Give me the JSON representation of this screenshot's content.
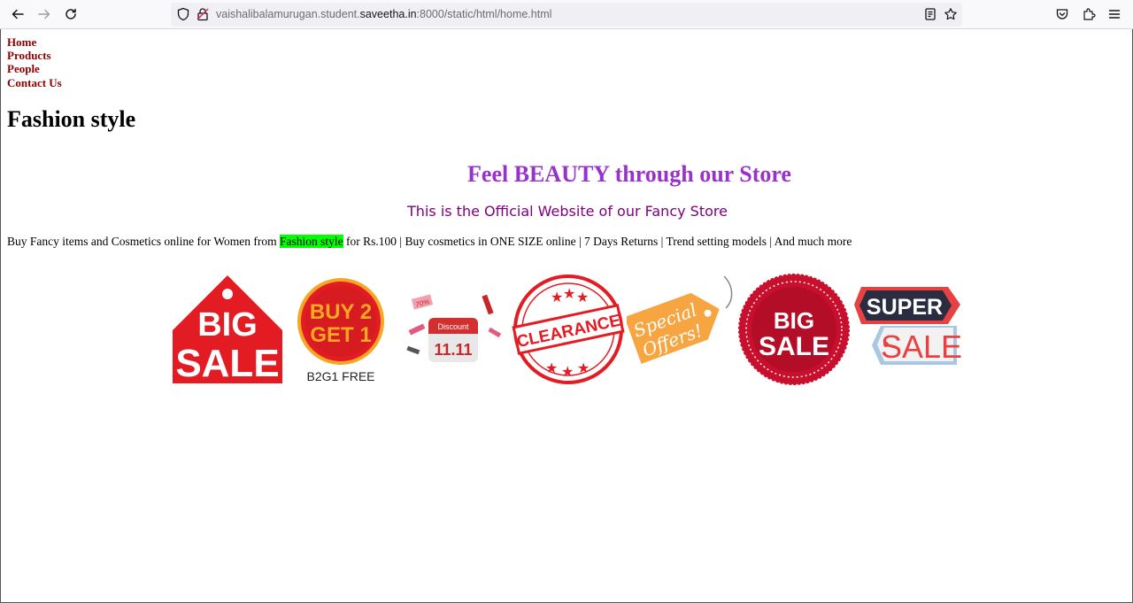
{
  "browser": {
    "url_prefix": "vaishalibalamurugan.student.",
    "url_domain": "saveetha.in",
    "url_suffix": ":8000/static/html/home.html"
  },
  "nav": {
    "items": [
      "Home",
      "Products",
      "People",
      "Contact Us"
    ]
  },
  "heading": "Fashion style",
  "tagline": "Feel BEAUTY through our Store",
  "subline": "This is the Official Website of our Fancy Store",
  "description": {
    "before": "Buy Fancy items and Cosmetics online for Women from ",
    "highlight": "Fashion style",
    "after": " for Rs.100 | Buy cosmetics in ONE SIZE online | 7 Days Returns | Trend setting models | And much more"
  },
  "badges": {
    "big_sale": {
      "line1": "BIG",
      "line2": "SALE"
    },
    "buy2get1": {
      "line1": "BUY 2",
      "line2": "GET 1",
      "caption": "B2G1 FREE"
    },
    "discount": {
      "title": "Discount",
      "date": "11.11",
      "tag": "70%"
    },
    "clearance": {
      "text": "CLEARANCE"
    },
    "special": {
      "line1": "Special",
      "line2": "Offers!"
    },
    "big_sale_seal": {
      "line1": "BIG",
      "line2": "SALE"
    },
    "super_sale": {
      "line1": "SUPER",
      "line2": "SALE"
    }
  },
  "colors": {
    "nav_link": "#8b0000",
    "tagline": "#9932cc",
    "subline": "#800080",
    "highlight": "#00ff00",
    "sale_red": "#e31b23"
  }
}
